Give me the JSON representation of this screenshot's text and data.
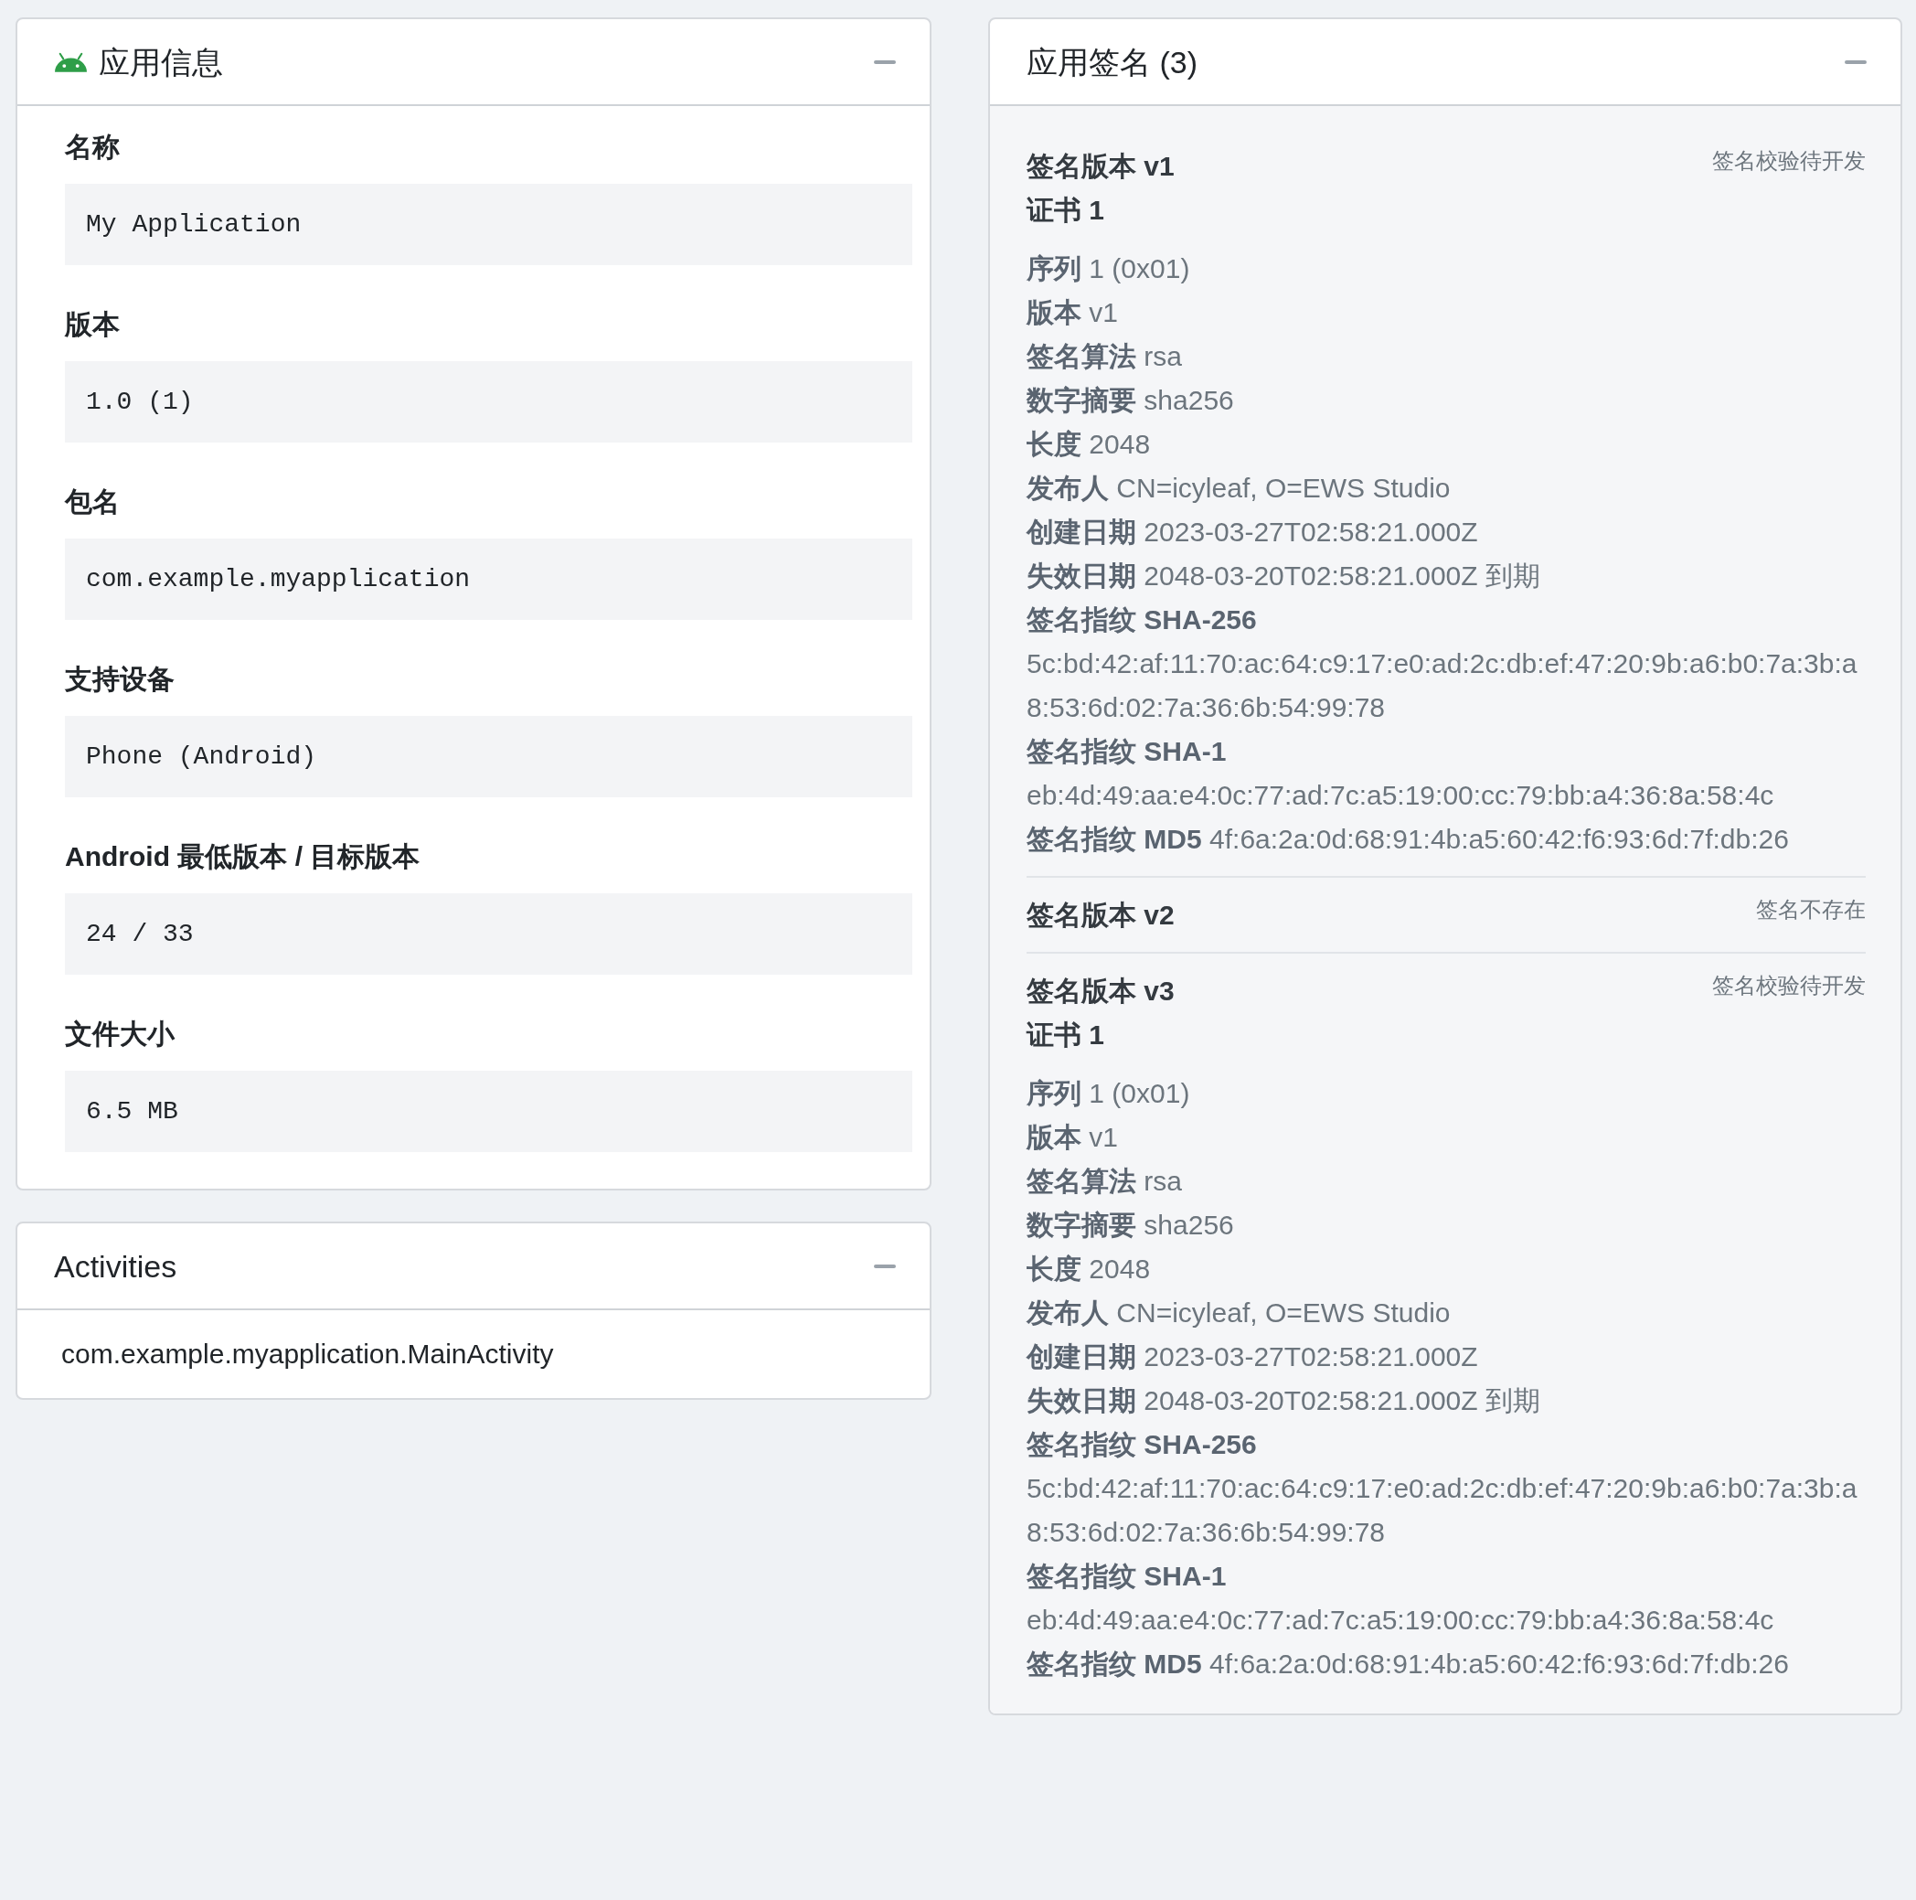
{
  "app_info": {
    "title": "应用信息",
    "expanded": true,
    "fields": [
      {
        "label": "名称",
        "value": "My Application"
      },
      {
        "label": "版本",
        "value": "1.0 (1)"
      },
      {
        "label": "包名",
        "value": "com.example.myapplication"
      },
      {
        "label": "支持设备",
        "value": "Phone (Android)"
      },
      {
        "label": "Android 最低版本 / 目标版本",
        "value": "24 / 33"
      },
      {
        "label": "文件大小",
        "value": "6.5 MB"
      }
    ]
  },
  "activities": {
    "title": "Activities",
    "expanded": true,
    "items": [
      "com.example.myapplication.MainActivity"
    ]
  },
  "signatures": {
    "title": "应用签名 (3)",
    "expanded": true,
    "versions": [
      {
        "title": "签名版本 v1",
        "status": "签名校验待开发",
        "certificates": [
          {
            "title": "证书 1",
            "lines": [
              "**序列** 1 (0x01)",
              "**版本** v1",
              "**签名算法** rsa",
              "**数字摘要** sha256",
              "**长度** 2048",
              "**发布人** CN=icyleaf, O=EWS Studio",
              "**创建日期** 2023-03-27T02:58:21.000Z",
              "**失效日期** 2048-03-20T02:58:21.000Z 到期",
              "**签名指纹 SHA-256** 5c:bd:42:af:11:70:ac:64:c9:17:e0:ad:2c:db:ef:47:20:9b:a6:b0:7a:3b:a8:53:6d:02:7a:36:6b:54:99:78",
              "**签名指纹 SHA-1** eb:4d:49:aa:e4:0c:77:ad:7c:a5:19:00:cc:79:bb:a4:36:8a:58:4c",
              "**签名指纹 MD5** 4f:6a:2a:0d:68:91:4b:a5:60:42:f6:93:6d:7f:db:26"
            ]
          }
        ]
      },
      {
        "title": "签名版本 v2",
        "status": "签名不存在"
      },
      {
        "title": "签名版本 v3",
        "status": "签名校验待开发",
        "certificates": [
          {
            "title": "证书 1",
            "lines": [
              "**序列** 1 (0x01)",
              "**版本** v1",
              "**签名算法** rsa",
              "**数字摘要** sha256",
              "**长度** 2048",
              "**发布人** CN=icyleaf, O=EWS Studio",
              "**创建日期** 2023-03-27T02:58:21.000Z",
              "**失效日期** 2048-03-20T02:58:21.000Z 到期",
              "**签名指纹 SHA-256** 5c:bd:42:af:11:70:ac:64:c9:17:e0:ad:2c:db:ef:47:20:9b:a6:b0:7a:3b:a8:53:6d:02:7a:36:6b:54:99:78",
              "**签名指纹 SHA-1** eb:4d:49:aa:e4:0c:77:ad:7c:a5:19:00:cc:79:bb:a4:36:8a:58:4c",
              "**签名指纹 MD5** 4f:6a:2a:0d:68:91:4b:a5:60:42:f6:93:6d:7f:db:26"
            ]
          }
        ]
      }
    ]
  }
}
